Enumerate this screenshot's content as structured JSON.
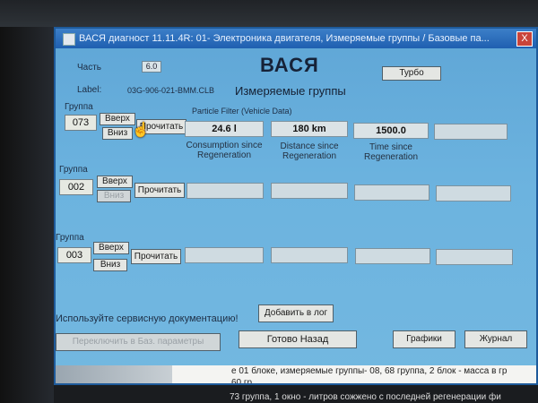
{
  "window": {
    "title": "ВАСЯ диагност 11.11.4R: 01- Электроника двигателя, Измеряемые группы / Базовые па...",
    "close_label": "X"
  },
  "header": {
    "part_label": "Часть",
    "part_value": "6.0",
    "label_label": "Label:",
    "label_value": "03G-906-021-BMM.CLB",
    "app_title": "ВАСЯ",
    "screen_title": "Измеряемые группы",
    "turbo_button": "Турбо"
  },
  "groups": [
    {
      "label": "Группа",
      "number": "073",
      "up": "Вверх",
      "down": "Вниз",
      "read": "Прочитать",
      "heading": "Particle Filter (Vehicle Data)",
      "values": [
        "24.6 l",
        "180 km",
        "1500.0",
        ""
      ],
      "captions": [
        "Consumption since Regeneration",
        "Distance since Regeneration",
        "Time since Regeneration",
        ""
      ]
    },
    {
      "label": "Группа",
      "number": "002",
      "up": "Вверх",
      "down": "Вниз",
      "read": "Прочитать",
      "values": [
        "",
        "",
        "",
        ""
      ]
    },
    {
      "label": "Группа",
      "number": "003",
      "up": "Вверх",
      "down": "Вниз",
      "read": "Прочитать",
      "values": [
        "",
        "",
        "",
        ""
      ]
    }
  ],
  "footer": {
    "service_doc_text": "Используйте сервисную документацию!",
    "add_log_button": "Добавить в лог",
    "switch_basic_button": "Переключить в Баз. параметры",
    "done_back_button": "Готово  Назад",
    "graphs_button": "Графики",
    "log_button": "Журнал"
  },
  "document_behind": {
    "line1": "е 01 блоке, измеряемые группы- 08, 68 группа, 2 блок - масса в гр",
    "line2": "60 гр.",
    "line3": "73 группа, 1 окно - литров сожжено с последней регенерации фи"
  }
}
